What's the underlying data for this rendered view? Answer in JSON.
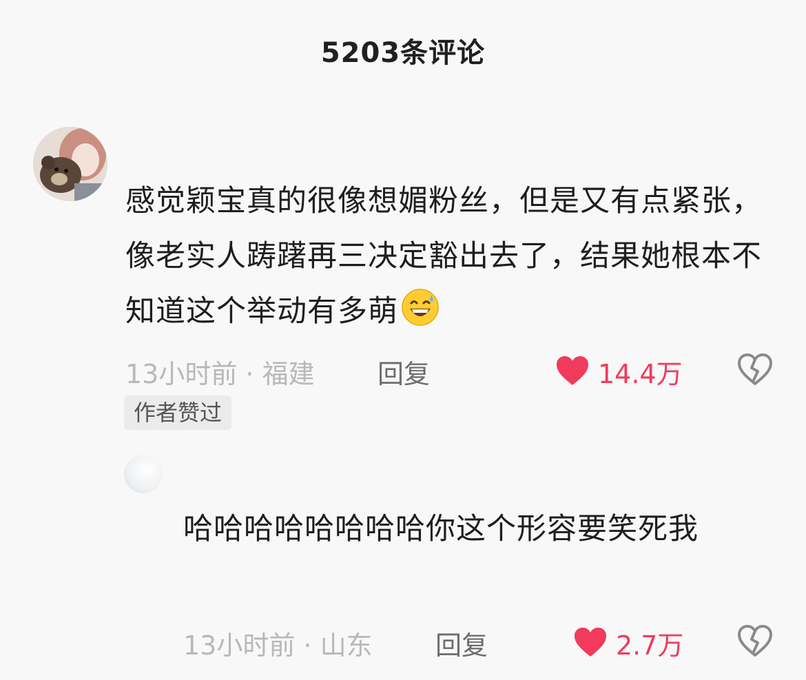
{
  "header": {
    "title": "5203条评论"
  },
  "comments": [
    {
      "text": "感觉颖宝真的很像想媚粉丝，但是又有点紧张，像老实人踌躇再三决定豁出去了，结果她根本不知道这个举动有多萌",
      "trailing_emoji": "grinning-sweat-emoji",
      "meta": "13小时前 · 福建",
      "reply_label": "回复",
      "likes": "14.4万",
      "badge": "作者赞过"
    },
    {
      "text": "哈哈哈哈哈哈哈哈你这个形容要笑死我",
      "meta": "13小时前 · 山东",
      "reply_label": "回复",
      "likes": "2.7万"
    }
  ],
  "colors": {
    "background": "#f8f8f8",
    "like_red": "#f13a5c",
    "meta_gray": "#b8b8b8",
    "text_dark": "#1e1e1e"
  }
}
